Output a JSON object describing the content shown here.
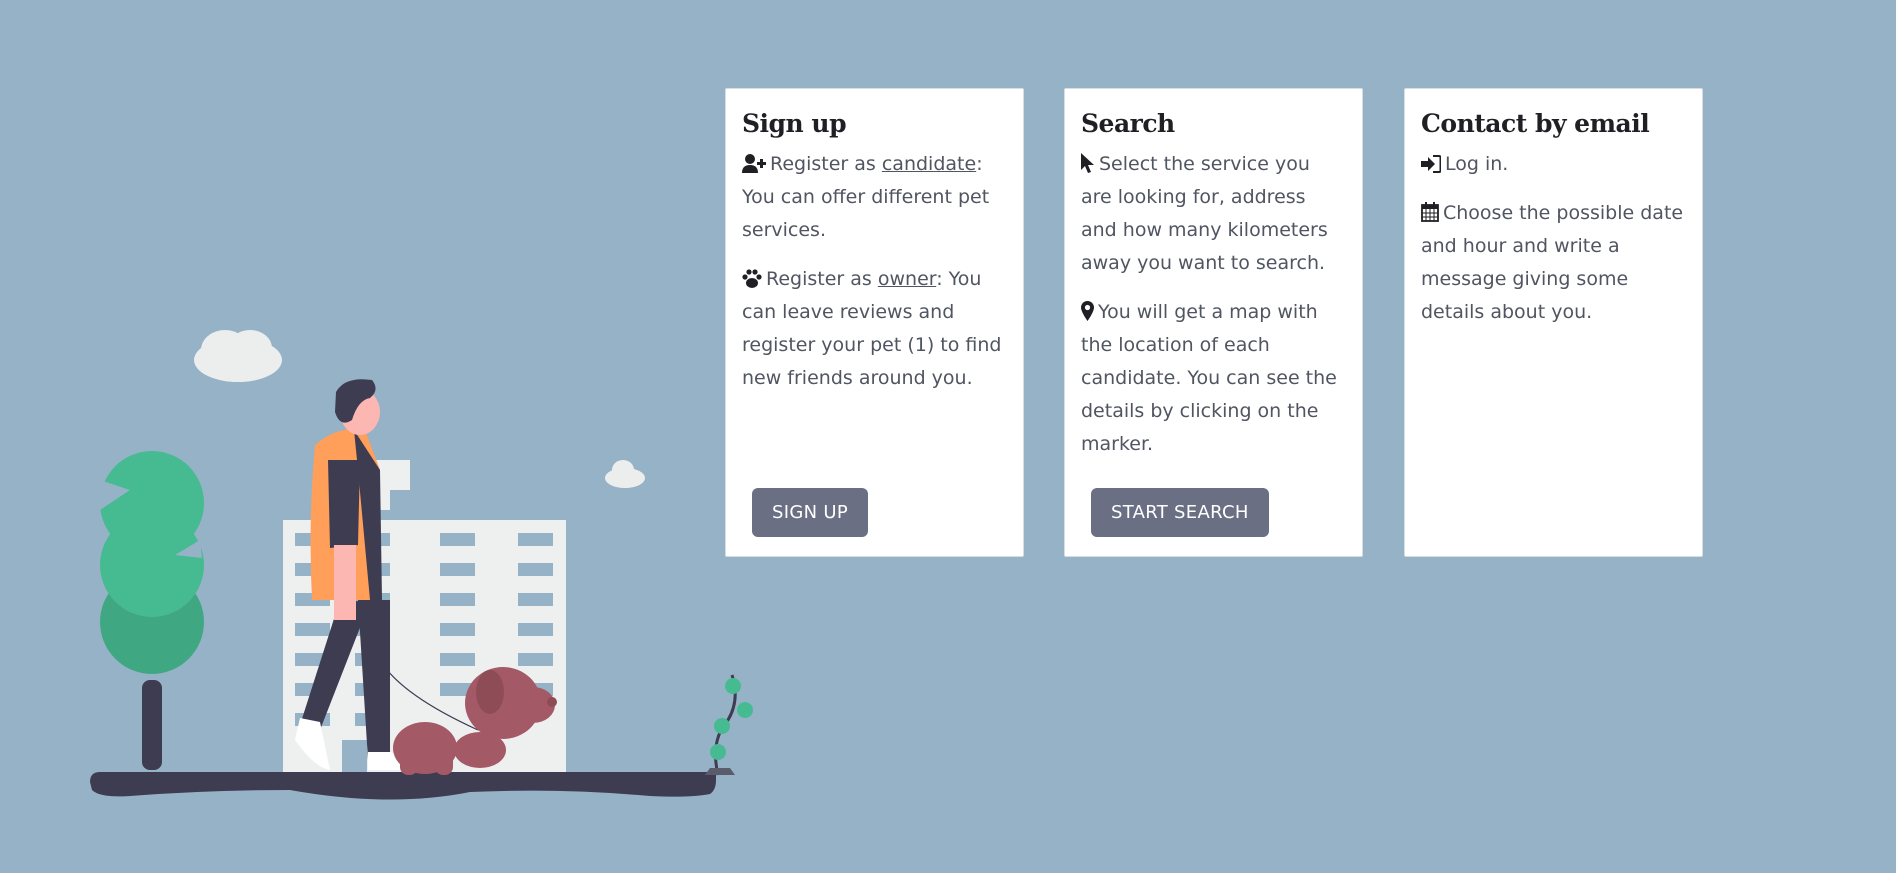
{
  "cards": [
    {
      "title": "Sign up",
      "items": [
        {
          "icon": "user-plus-icon",
          "pre": "Register as ",
          "link": "candidate",
          "post": ": You can offer different pet services."
        },
        {
          "icon": "paw-icon",
          "pre": "Register as ",
          "link": "owner",
          "post": ": You can leave reviews and register your pet (1) to find new friends around you."
        }
      ],
      "button": "SIGN UP"
    },
    {
      "title": "Search",
      "items": [
        {
          "icon": "cursor-icon",
          "text": "Select the service you are looking for, address and how many kilometers away you want to search."
        },
        {
          "icon": "map-marker-icon",
          "text": "You will get a map with the location of each candidate. You can see the details by clicking on the marker."
        }
      ],
      "button": "START SEARCH"
    },
    {
      "title": "Contact by email",
      "items": [
        {
          "icon": "sign-in-icon",
          "text": "Log in."
        },
        {
          "icon": "calendar-icon",
          "text": "Choose the possible date and hour and write a message giving some details about you."
        }
      ]
    }
  ],
  "colors": {
    "background": "#96b2c6",
    "card": "#ffffff",
    "button": "#6b6f83",
    "title": "#1f1f24",
    "text": "#505561"
  }
}
